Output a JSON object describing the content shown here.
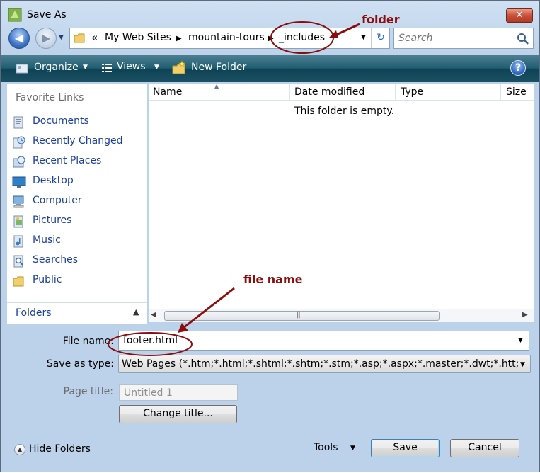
{
  "window": {
    "title": "Save As",
    "close_glyph": "✕"
  },
  "nav": {
    "back_glyph": "◀",
    "forward_glyph": "▶",
    "dropdown_glyph": "▼"
  },
  "address": {
    "overflow_glyph": "«",
    "crumbs": [
      "My Web Sites",
      "mountain-tours",
      "_includes"
    ],
    "separator_glyph": "▶",
    "dropdown_glyph": "▼",
    "refresh_glyph": "↻"
  },
  "search": {
    "placeholder": "Search"
  },
  "toolbar": {
    "organize": "Organize",
    "views": "Views",
    "new_folder": "New Folder",
    "dropdown_glyph": "▼",
    "help_glyph": "?"
  },
  "nav_pane": {
    "favorite_links_title": "Favorite Links",
    "links": [
      {
        "label": "Documents",
        "icon": "documents-icon"
      },
      {
        "label": "Recently Changed",
        "icon": "recently-changed-icon"
      },
      {
        "label": "Recent Places",
        "icon": "recent-places-icon"
      },
      {
        "label": "Desktop",
        "icon": "desktop-icon"
      },
      {
        "label": "Computer",
        "icon": "computer-icon"
      },
      {
        "label": "Pictures",
        "icon": "pictures-icon"
      },
      {
        "label": "Music",
        "icon": "music-icon"
      },
      {
        "label": "Searches",
        "icon": "searches-icon"
      },
      {
        "label": "Public",
        "icon": "public-folder-icon"
      }
    ],
    "folders_label": "Folders",
    "folders_toggle_glyph": "▲"
  },
  "file_list": {
    "columns": [
      "Name",
      "Date modified",
      "Type",
      "Size"
    ],
    "empty_message": "This folder is empty.",
    "sort_glyph": "▲"
  },
  "scrollbar": {
    "left_glyph": "◀",
    "right_glyph": "▶",
    "grip_glyph": "|||"
  },
  "form": {
    "file_name_label": "File name:",
    "file_name_value": "footer.html",
    "save_as_type_label": "Save as type:",
    "save_as_type_value": "Web Pages (*.htm;*.html;*.shtml;*.shtm;*.stm;*.asp;*.aspx;*.master;*.dwt;*.htt;*.hta;*.htc",
    "page_title_label": "Page title:",
    "page_title_value": "Untitled 1",
    "change_title_button": "Change title...",
    "dropdown_glyph": "▼"
  },
  "footer": {
    "hide_folders": "Hide Folders",
    "hide_folders_glyph": "▲",
    "tools": "Tools",
    "tools_dropdown_glyph": "▼",
    "save": "Save",
    "cancel": "Cancel"
  },
  "annotations": {
    "folder": "folder",
    "file_name": "file name",
    "color": "#8b0d0d"
  }
}
